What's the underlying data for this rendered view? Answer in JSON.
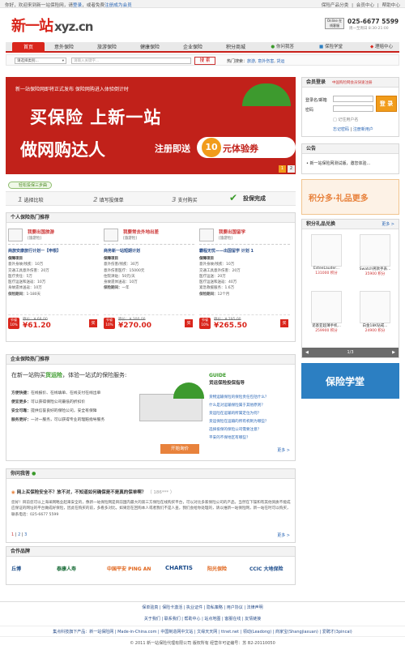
{
  "topbar": {
    "greeting": "你好，欢迎来到新一站保险网，请",
    "login": "登录",
    "or": "，或者免费",
    "register": "注册成为会员",
    "right_items": [
      "保险产品分类",
      "会员中心",
      "帮助中心"
    ]
  },
  "brand": {
    "logo_cn": "新一站",
    "logo_en": "xyz.cn",
    "online_label": "Online 在线客服",
    "phone": "025-6677 5599",
    "phone_sub": "周一至周日 8:30-21:00"
  },
  "nav": {
    "items": [
      "首页",
      "意外保险",
      "旅游保险",
      "健康保险",
      "企业保险",
      "积分商城"
    ],
    "ext": [
      "你问我答",
      "保险学堂",
      "理赔中心"
    ]
  },
  "search": {
    "category_placeholder": "请选择类别...",
    "input_placeholder": "请输入关键字...",
    "button": "搜 索",
    "hot_label": "热门搜索：",
    "hot": [
      "旅游",
      "意外伤害",
      "货运"
    ]
  },
  "banner": {
    "line1": "新一站保险网即将正式发布 保险网购进入体验倒计时",
    "t1": "买保险  上新一站",
    "t2": "做网购达人",
    "t3": "注册即送",
    "amount": "10",
    "t4": "元体验券",
    "pages": [
      "1",
      "2"
    ]
  },
  "login": {
    "title": "会员登录",
    "note": "中国购险网会员快速注册",
    "user_label": "登录名/邮箱",
    "pwd_label": "密码",
    "btn": "登 录",
    "remember": "记住用户名",
    "forgot": "忘记密码",
    "signup": "注册新用户"
  },
  "notice": {
    "title": "公告",
    "items": [
      "新一站保险网测试版，邀您体验..."
    ]
  },
  "steps": {
    "badge": "轻松投保三步曲",
    "s1": "选择比较",
    "s2": "填写投保单",
    "s3": "支付购买",
    "final": "投保完成"
  },
  "personal": {
    "title": "个人保险热门推荐",
    "cards": [
      {
        "head": "我要出国旅游",
        "tag": "[旅游险]",
        "name": "商旅安康旅行计划一【申根】",
        "lines": [
          "保障项目",
          "意外身故/残疾：10万",
          "交通工具意外伤害：20万",
          "医疗责任：5万",
          "医疗运送和送返：10万",
          "身故遗体送返：10万"
        ],
        "period_label": "保险期间：",
        "period": "1-180天",
        "pct": "节省 10%",
        "old": "原价：¥ 68.00",
        "new": "¥61.20",
        "buy": "买"
      },
      {
        "head": "我要常去外地出差",
        "tag": "[旅游险]",
        "name": "商务新一站短期计划",
        "lines": [
          "保障项目",
          "意外伤害/残疾：30万",
          "意外伤害医疗：15000元",
          "住院津贴：50元/天",
          "身故遗体送返：10万"
        ],
        "period_label": "保险期间：",
        "period": "一年",
        "pct": "节省 10%",
        "old": "原价：¥ 300.00",
        "new": "¥270.00",
        "buy": "买"
      },
      {
        "head": "我要出国留学",
        "tag": "[旅游险]",
        "name": "霸程无忧——出国留学 计划 1",
        "lines": [
          "保障项目",
          "意外身故/残疾：10万",
          "交通工具意外伤害：20万",
          "医疗运送：20万",
          "医疗运送和送返：40万",
          "紧急救援服务：1.6万"
        ],
        "period_label": "保险期间：",
        "period": "12个月",
        "pct": "节省 10%",
        "old": "原价：¥ 295.00",
        "new": "¥265.50",
        "buy": "买"
      }
    ]
  },
  "enterprise": {
    "title": "企业保险热门推荐",
    "lead1": "在新一站购买",
    "lead_hl": "货运险",
    "lead2": "，体验一站式的保险服务:",
    "rows": [
      [
        "方便快捷：",
        "在线报价、在线填单、在线支付在线出单"
      ],
      [
        "便宜更多：",
        "可以获得保险公司最低的折扣价"
      ],
      [
        "安全可靠：",
        "提供信誉良好的保险公司，安全有保障"
      ],
      [
        "服务更好：",
        "一对一服务，可以获得专业的理赔指导服务"
      ]
    ],
    "cta": "开始询价",
    "guide_en": "GUIDE",
    "guide_cn": "货运保险投保指导",
    "guide_items": [
      "货物运输保险的保险责任包括什么？",
      "什么是对运输保险属于其他原则？",
      "货运险在运输的所属定位为何？",
      "货运保险在运输的所有机制为哪些？",
      "选择投保的保险公司需要注意？",
      "平安的不保地区有哪些？"
    ],
    "more": "更多 >"
  },
  "qa": {
    "title": "你问我答",
    "q": "网上买保险安全不？放不对，不知道如何确保是不是真的保单啊？",
    "q_meta": "（ 186*** ）",
    "a": "您好！目前您可以上海采网略业起来安全的，像新一站保险网是目前国内最大的第三方保险在线购买平台，可以对比多家保险公司的产品，当然在下操和有其他资质不能成应保证的网址的平台做成好保险，因此在购买的前，多看多对比。如果您在回购本人或者我们不是人查，我们会给你处理的，请以维新一站保险网，新一站在时可以购买，联系电话：025-6677 5599",
    "pages": [
      "1",
      "2",
      "3"
    ],
    "more": "更多 >"
  },
  "partners": {
    "title": "合作品牌",
    "items": [
      "丘博",
      "泰康人寿",
      "中国平安 PING AN",
      "CHARTIS",
      "阳光保险",
      "CCIC 大地保险"
    ]
  },
  "gifts": {
    "title": "积分礼品兑换",
    "more": "更多 >",
    "banner": "积分多·礼品更多",
    "items": [
      {
        "name": "EsteeLauder...",
        "pts": "131000 积分"
      },
      {
        "name": "Swatch男款手表...",
        "pts": "35900 积分"
      },
      {
        "name": "诺基亚超薄手机...",
        "pts": "259900 积分"
      },
      {
        "name": "白金18K钻戒...",
        "pts": "24900 积分"
      }
    ],
    "pager": "1/3"
  },
  "insbanner": {
    "text": "保险学堂"
  },
  "footer": {
    "row1": "保单验真 | 保险卡激活 | 执业证件 | 隐私策略 | 用户协议 | 法律声明",
    "row2": "关于我们 | 联系我们 | 帮助中心 | 站点地图 | 客服在线 | 友情链接",
    "row3": "集点科技旗下产品：新一站保险网 | Made-in-China.com | 中国制造网中文站 | 文缘天天网 | ttnet.net | 领动(Leadong) | 商家宝(Shangjiaxuan) | 爱聘才(3pincai)",
    "row4": "© 2011 新一站保险代理有限公司 版权所有  经营许可证编号：苏 B2-20110050"
  }
}
